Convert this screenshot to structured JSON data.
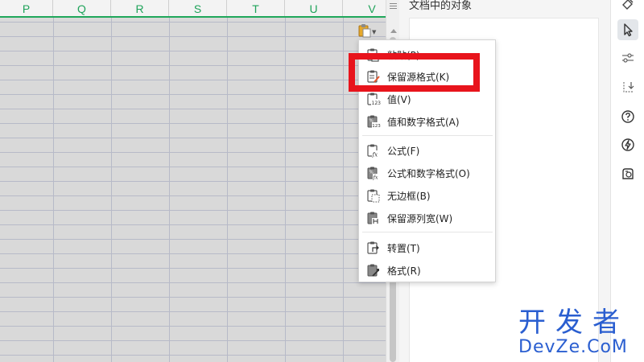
{
  "sheet": {
    "columns": [
      "P",
      "Q",
      "R",
      "S",
      "T",
      "U",
      "V"
    ]
  },
  "panel": {
    "title": "文档中的对象"
  },
  "context_menu": {
    "items": [
      {
        "label": "粘贴(P)",
        "icon": "paste-icon"
      },
      {
        "label": "保留源格式(K)",
        "icon": "keep-source-format-icon"
      },
      {
        "label": "值(V)",
        "icon": "paste-values-icon"
      },
      {
        "label": "值和数字格式(A)",
        "icon": "values-number-format-icon"
      },
      {
        "label": "公式(F)",
        "icon": "formula-icon"
      },
      {
        "label": "公式和数字格式(O)",
        "icon": "formula-number-format-icon"
      },
      {
        "label": "无边框(B)",
        "icon": "no-borders-icon"
      },
      {
        "label": "保留源列宽(W)",
        "icon": "keep-column-width-icon"
      },
      {
        "label": "转置(T)",
        "icon": "transpose-icon"
      },
      {
        "label": "格式(R)",
        "icon": "format-icon"
      }
    ],
    "highlighted_item": "保留源格式(K)"
  },
  "toolbar": {
    "icons": [
      "style-icon",
      "select-cursor-icon",
      "sliders-icon",
      "transform-icon",
      "help-icon",
      "lightning-icon",
      "backup-icon"
    ],
    "active": "select-cursor-icon"
  },
  "watermark": {
    "cn": "开发者",
    "en": "DevZe.CoM"
  },
  "colors": {
    "column_header_text": "#1fa35a",
    "highlight_box": "#e8141c",
    "watermark": "#2a5ed0",
    "sheet_selection": "#d9d9d9"
  }
}
